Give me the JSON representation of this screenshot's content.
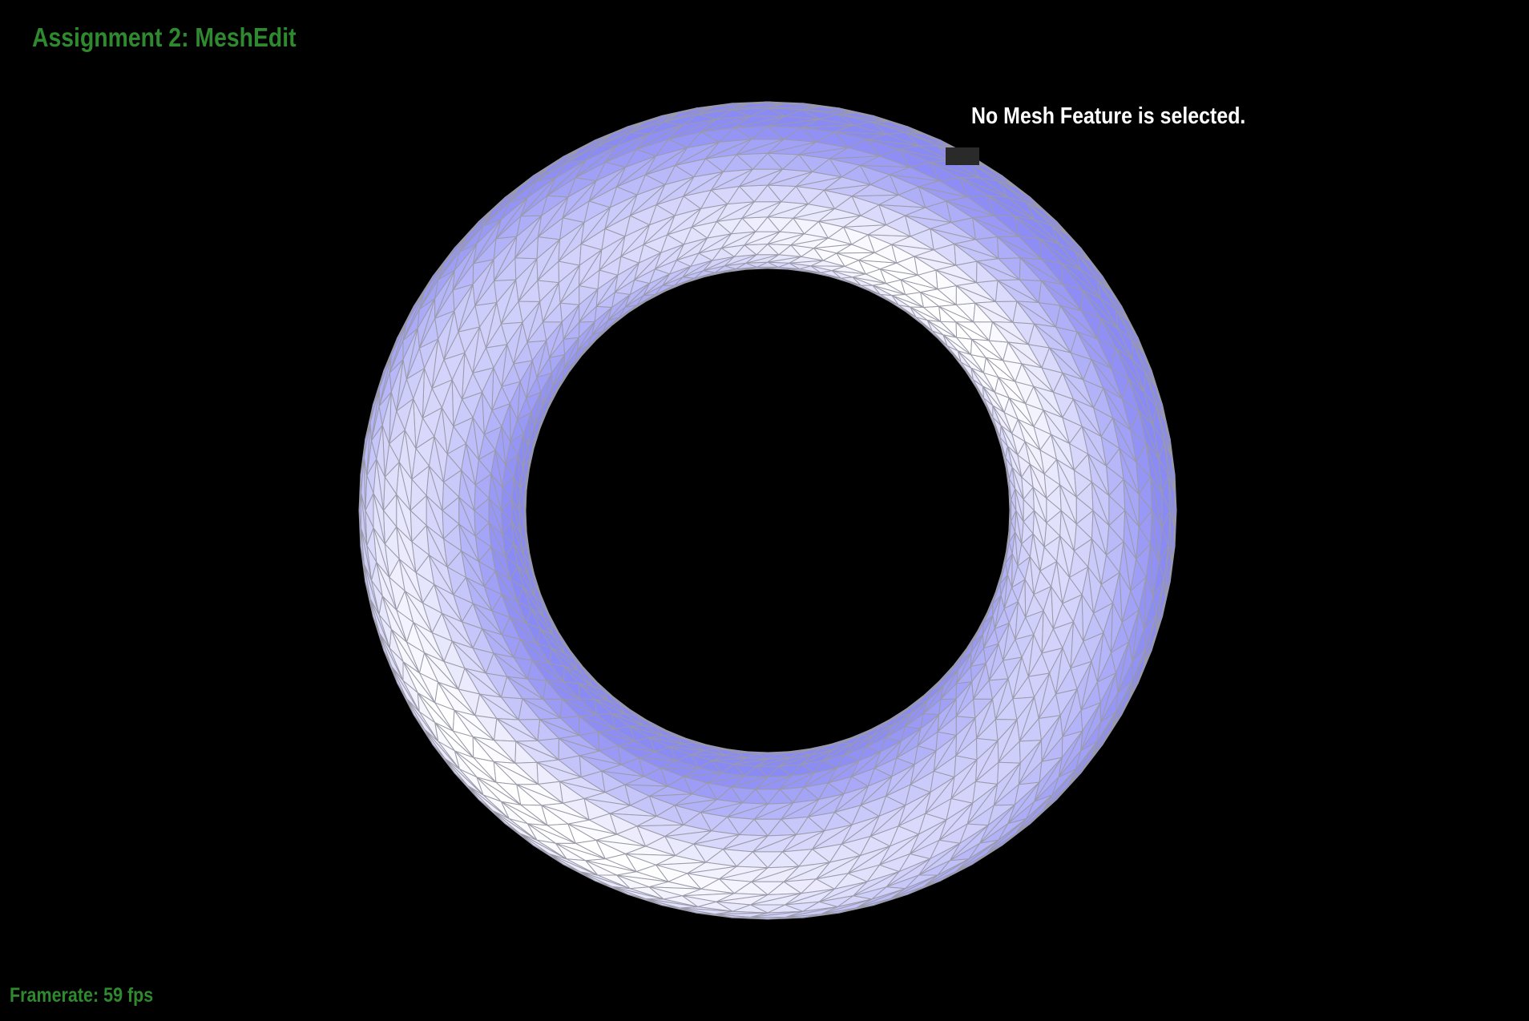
{
  "app": {
    "title": "Assignment 2: MeshEdit"
  },
  "selection": {
    "status_text": "No Mesh Feature is selected."
  },
  "stats": {
    "framerate_text": "Framerate: 59 fps"
  },
  "scene": {
    "mesh": "torus",
    "background_color": "#000000",
    "face_base_color": "#8a8af5",
    "face_highlight_color": "#ffffff",
    "edge_color": "#9a9aa8",
    "hud_text_color": "#2f8a2f",
    "info_text_color": "#ffffff"
  }
}
